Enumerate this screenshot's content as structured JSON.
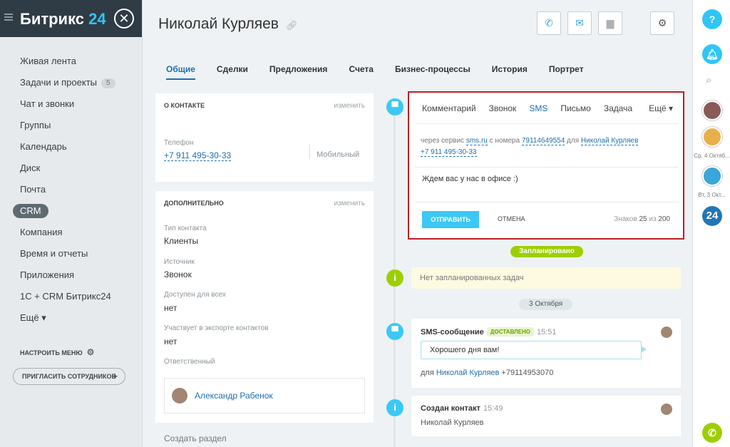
{
  "brand": {
    "name": "Битрикс",
    "number": "24"
  },
  "sidebar": {
    "items": [
      {
        "label": "Живая лента"
      },
      {
        "label": "Задачи и проекты",
        "counter": "5"
      },
      {
        "label": "Чат и звонки"
      },
      {
        "label": "Группы"
      },
      {
        "label": "Календарь"
      },
      {
        "label": "Диск"
      },
      {
        "label": "Почта"
      },
      {
        "label": "CRM"
      },
      {
        "label": "Компания"
      },
      {
        "label": "Время и отчеты"
      },
      {
        "label": "Приложения"
      },
      {
        "label": "1С + CRM Битрикс24"
      },
      {
        "label": "Ещё ▾"
      }
    ],
    "configure_label": "НАСТРОИТЬ МЕНЮ",
    "invite_label": "ПРИГЛАСИТЬ СОТРУДНИКОВ"
  },
  "header": {
    "title": "Николай Курляев"
  },
  "tabs": [
    "Общие",
    "Сделки",
    "Предложения",
    "Счета",
    "Бизнес-процессы",
    "История",
    "Портрет"
  ],
  "contact_card": {
    "heading": "О КОНТАКТЕ",
    "edit": "изменить",
    "phone_label": "Телефон",
    "phone": "+7 911 495-30-33",
    "phone_type": "Мобильный"
  },
  "extra_card": {
    "heading": "ДОПОЛНИТЕЛЬНО",
    "edit": "изменить",
    "fields": [
      {
        "label": "Тип контакта",
        "value": "Клиенты"
      },
      {
        "label": "Источник",
        "value": "Звонок"
      },
      {
        "label": "Доступен для всех",
        "value": "нет"
      },
      {
        "label": "Участвует в экспорте контактов",
        "value": "нет"
      }
    ],
    "responsible_label": "Ответственный",
    "responsible_name": "Александр Рабенок"
  },
  "create_section": "Создать раздел",
  "sms_editor": {
    "tabs": [
      "Комментарий",
      "Звонок",
      "SMS",
      "Письмо",
      "Задача"
    ],
    "more": "Ещё ▾",
    "via_text": "через сервис",
    "service": "sms.ru",
    "from_text": "с номера",
    "from_number": "79114649554",
    "to_text": "для",
    "to_name": "Николай Курляев",
    "to_phone": "+7 911 495-30-33",
    "message": "Ждем вас у нас в офисе :)",
    "send": "ОТПРАВИТЬ",
    "cancel": "ОТМЕНА",
    "chars_label": "Знаков",
    "chars_count": "25",
    "chars_of": "из",
    "chars_max": "200"
  },
  "timeline": {
    "planned_badge": "Запланировано",
    "no_tasks": "Нет запланированных задач",
    "date_badge": "3 Октября",
    "sms_item": {
      "title": "SMS-сообщение",
      "status": "ДОСТАВЛЕНО",
      "time": "15:51",
      "text": "Хорошего дня вам!",
      "for_text": "для",
      "for_name": "Николай Курляев",
      "for_phone": "+79114953070"
    },
    "created_item": {
      "title": "Создан контакт",
      "time": "15:49",
      "name": "Николай Курляев"
    }
  },
  "right_panel": {
    "date1": "Ср, 4 Октяб...",
    "date2": "Вт, 3 Окт...",
    "badge_24": "24"
  }
}
